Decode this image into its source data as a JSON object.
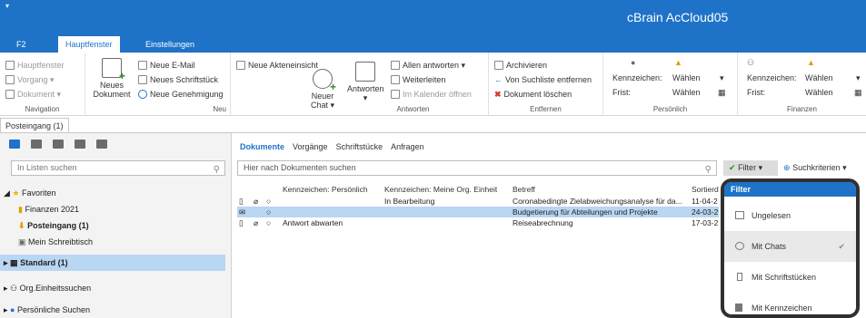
{
  "app": {
    "title": "cBrain AcCloud05",
    "quick_access": "▾"
  },
  "tabs": [
    "F2",
    "Hauptfenster",
    "Einstellungen"
  ],
  "ribbon": {
    "navigation": {
      "label": "Navigation",
      "items": [
        "Hauptfenster",
        "Vorgang ▾",
        "Dokument ▾"
      ]
    },
    "neu": {
      "label": "Neu",
      "big_button": "Neues\nDokument",
      "items": [
        "Neue E-Mail",
        "Neues Schriftstück",
        "Neue Genehmigung"
      ]
    },
    "akteneinsicht": "Neue Akteneinsicht",
    "chat": "Neuer\nChat ▾",
    "antworten": {
      "label": "Antworten",
      "big_button": "Antworten\n▾",
      "items": [
        "Allen antworten ▾",
        "Weiterleiten",
        "Im Kalender öffnen"
      ]
    },
    "entfernen": {
      "label": "Entfernen",
      "items": [
        "Archivieren",
        "Von Suchliste entfernen",
        "Dokument löschen"
      ]
    },
    "persoenlich": {
      "label": "Persönlich",
      "kennzeichen": "Kennzeichen:",
      "frist": "Frist:",
      "waehlen1": "Wählen",
      "waehlen2": "Wählen"
    },
    "finanzen": {
      "label": "Finanzen",
      "kennzeichen": "Kennzeichen:",
      "frist": "Frist:",
      "waehlen1": "Wählen",
      "waehlen2": "Wählen"
    }
  },
  "queue_tab": "Posteingang (1)",
  "left": {
    "search_placeholder": "In Listen suchen",
    "tree": [
      {
        "label": "Favoriten"
      },
      {
        "label": "Finanzen 2021"
      },
      {
        "label": "Posteingang (1)"
      },
      {
        "label": "Mein Schreibtisch"
      },
      {
        "label": "Standard (1)"
      },
      {
        "label": "Org.Einheitssuchen"
      },
      {
        "label": "Persönliche Suchen"
      }
    ]
  },
  "main": {
    "tabs": [
      "Dokumente",
      "Vorgänge",
      "Schriftstücke",
      "Anfragen"
    ],
    "search_placeholder": "Hier nach Dokumenten suchen",
    "filter_label": "Filter ▾",
    "criteria_label": "Suchkriterien ▾",
    "columns": [
      "Kennzeichen: Persönlich",
      "Kennzeichen: Meine Org. Einheit",
      "Betreff",
      "Sortierd"
    ],
    "rows": [
      {
        "personal": "",
        "org": "In Bearbeitung",
        "subject": "Coronabedingte Zielabweichungsanalyse für da...",
        "date": "11-04-2"
      },
      {
        "personal": "",
        "org": "",
        "subject": "Budgetierung für Abteilungen und Projekte",
        "date": "24-03-2"
      },
      {
        "personal": "Antwort abwarten",
        "org": "",
        "subject": "Reiseabrechnung",
        "date": "17-03-2"
      }
    ]
  },
  "filter_popup": {
    "title": "Filter",
    "items": [
      "Ungelesen",
      "Mit Chats",
      "Mit Schriftstücken",
      "Mit Kennzeichen"
    ]
  }
}
